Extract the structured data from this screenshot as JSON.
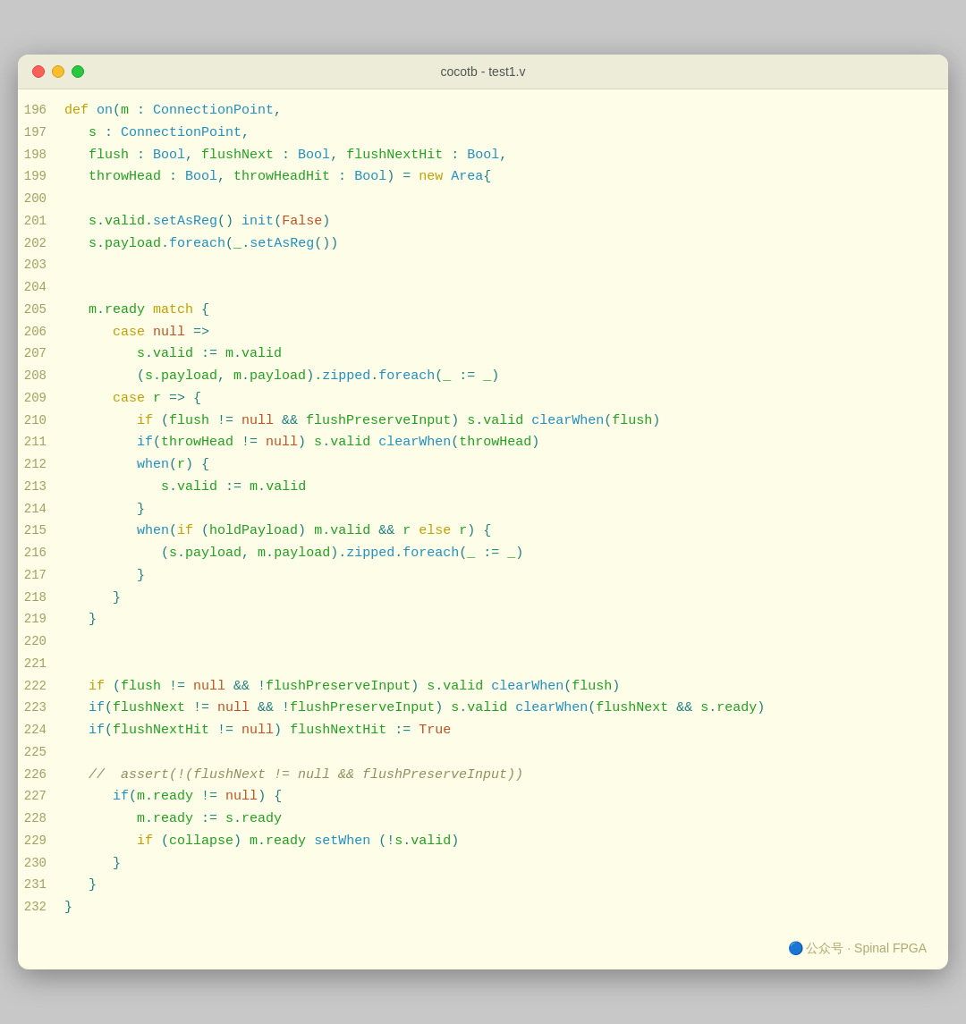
{
  "window": {
    "title": "cocotb - test1.v",
    "traffic_lights": [
      "red",
      "yellow",
      "green"
    ]
  },
  "watermark": "🔵 公众号 · Spinal FPGA",
  "lines": [
    {
      "n": 196,
      "tokens": [
        {
          "t": "kw",
          "v": "def "
        },
        {
          "t": "fn",
          "v": "on"
        },
        {
          "t": "pl",
          "v": "("
        },
        {
          "t": "id",
          "v": "m"
        },
        {
          "t": "pl",
          "v": " : "
        },
        {
          "t": "ty",
          "v": "ConnectionPoint"
        },
        {
          "t": "pl",
          "v": ","
        }
      ]
    },
    {
      "n": 197,
      "tokens": [
        {
          "t": "pl",
          "v": "   "
        },
        {
          "t": "id",
          "v": "s"
        },
        {
          "t": "pl",
          "v": " : "
        },
        {
          "t": "ty",
          "v": "ConnectionPoint"
        },
        {
          "t": "pl",
          "v": ","
        }
      ]
    },
    {
      "n": 198,
      "tokens": [
        {
          "t": "pl",
          "v": "   "
        },
        {
          "t": "id",
          "v": "flush"
        },
        {
          "t": "pl",
          "v": " : "
        },
        {
          "t": "ty",
          "v": "Bool"
        },
        {
          "t": "pl",
          "v": ", "
        },
        {
          "t": "id",
          "v": "flushNext"
        },
        {
          "t": "pl",
          "v": " : "
        },
        {
          "t": "ty",
          "v": "Bool"
        },
        {
          "t": "pl",
          "v": ", "
        },
        {
          "t": "id",
          "v": "flushNextHit"
        },
        {
          "t": "pl",
          "v": " : "
        },
        {
          "t": "ty",
          "v": "Bool"
        },
        {
          "t": "pl",
          "v": ","
        }
      ]
    },
    {
      "n": 199,
      "tokens": [
        {
          "t": "pl",
          "v": "   "
        },
        {
          "t": "id",
          "v": "throwHead"
        },
        {
          "t": "pl",
          "v": " : "
        },
        {
          "t": "ty",
          "v": "Bool"
        },
        {
          "t": "pl",
          "v": ", "
        },
        {
          "t": "id",
          "v": "throwHeadHit"
        },
        {
          "t": "pl",
          "v": " : "
        },
        {
          "t": "ty",
          "v": "Bool"
        },
        {
          "t": "pl",
          "v": ") = "
        },
        {
          "t": "kw",
          "v": "new "
        },
        {
          "t": "ty",
          "v": "Area"
        },
        {
          "t": "pl",
          "v": "{"
        }
      ]
    },
    {
      "n": 200,
      "tokens": []
    },
    {
      "n": 201,
      "tokens": [
        {
          "t": "pl",
          "v": "   "
        },
        {
          "t": "id",
          "v": "s"
        },
        {
          "t": "pl",
          "v": "."
        },
        {
          "t": "id",
          "v": "valid"
        },
        {
          "t": "pl",
          "v": "."
        },
        {
          "t": "fn",
          "v": "setAsReg"
        },
        {
          "t": "pl",
          "v": "() "
        },
        {
          "t": "fn",
          "v": "init"
        },
        {
          "t": "pl",
          "v": "("
        },
        {
          "t": "lit",
          "v": "False"
        },
        {
          "t": "pl",
          "v": ")"
        }
      ]
    },
    {
      "n": 202,
      "tokens": [
        {
          "t": "pl",
          "v": "   "
        },
        {
          "t": "id",
          "v": "s"
        },
        {
          "t": "pl",
          "v": "."
        },
        {
          "t": "id",
          "v": "payload"
        },
        {
          "t": "pl",
          "v": "."
        },
        {
          "t": "fn",
          "v": "foreach"
        },
        {
          "t": "pl",
          "v": "("
        },
        {
          "t": "id",
          "v": "_"
        },
        {
          "t": "pl",
          "v": "."
        },
        {
          "t": "fn",
          "v": "setAsReg"
        },
        {
          "t": "pl",
          "v": "())"
        }
      ]
    },
    {
      "n": 203,
      "tokens": []
    },
    {
      "n": 204,
      "tokens": []
    },
    {
      "n": 205,
      "tokens": [
        {
          "t": "pl",
          "v": "   "
        },
        {
          "t": "id",
          "v": "m"
        },
        {
          "t": "pl",
          "v": "."
        },
        {
          "t": "id",
          "v": "ready"
        },
        {
          "t": "pl",
          "v": " "
        },
        {
          "t": "kw",
          "v": "match"
        },
        {
          "t": "pl",
          "v": " {"
        }
      ]
    },
    {
      "n": 206,
      "tokens": [
        {
          "t": "pl",
          "v": "      "
        },
        {
          "t": "kw",
          "v": "case "
        },
        {
          "t": "lit",
          "v": "null"
        },
        {
          "t": "pl",
          "v": " =>"
        }
      ]
    },
    {
      "n": 207,
      "tokens": [
        {
          "t": "pl",
          "v": "         "
        },
        {
          "t": "id",
          "v": "s"
        },
        {
          "t": "pl",
          "v": "."
        },
        {
          "t": "id",
          "v": "valid"
        },
        {
          "t": "pl",
          "v": " := "
        },
        {
          "t": "id",
          "v": "m"
        },
        {
          "t": "pl",
          "v": "."
        },
        {
          "t": "id",
          "v": "valid"
        }
      ]
    },
    {
      "n": 208,
      "tokens": [
        {
          "t": "pl",
          "v": "         ("
        },
        {
          "t": "id",
          "v": "s"
        },
        {
          "t": "pl",
          "v": "."
        },
        {
          "t": "id",
          "v": "payload"
        },
        {
          "t": "pl",
          "v": ", "
        },
        {
          "t": "id",
          "v": "m"
        },
        {
          "t": "pl",
          "v": "."
        },
        {
          "t": "id",
          "v": "payload"
        },
        {
          "t": "pl",
          "v": ")."
        },
        {
          "t": "fn",
          "v": "zipped"
        },
        {
          "t": "pl",
          "v": "."
        },
        {
          "t": "fn",
          "v": "foreach"
        },
        {
          "t": "pl",
          "v": "("
        },
        {
          "t": "id",
          "v": "_"
        },
        {
          "t": "pl",
          "v": " := "
        },
        {
          "t": "id",
          "v": "_"
        },
        {
          "t": "pl",
          "v": ")"
        }
      ]
    },
    {
      "n": 209,
      "tokens": [
        {
          "t": "pl",
          "v": "      "
        },
        {
          "t": "kw",
          "v": "case "
        },
        {
          "t": "id",
          "v": "r"
        },
        {
          "t": "pl",
          "v": " => {"
        }
      ]
    },
    {
      "n": 210,
      "tokens": [
        {
          "t": "pl",
          "v": "         "
        },
        {
          "t": "kw",
          "v": "if "
        },
        {
          "t": "pl",
          "v": "("
        },
        {
          "t": "id",
          "v": "flush"
        },
        {
          "t": "pl",
          "v": " != "
        },
        {
          "t": "lit",
          "v": "null"
        },
        {
          "t": "pl",
          "v": " && "
        },
        {
          "t": "id",
          "v": "flushPreserveInput"
        },
        {
          "t": "pl",
          "v": ") "
        },
        {
          "t": "id",
          "v": "s"
        },
        {
          "t": "pl",
          "v": "."
        },
        {
          "t": "id",
          "v": "valid"
        },
        {
          "t": "pl",
          "v": " "
        },
        {
          "t": "fn",
          "v": "clearWhen"
        },
        {
          "t": "pl",
          "v": "("
        },
        {
          "t": "id",
          "v": "flush"
        },
        {
          "t": "pl",
          "v": ")"
        }
      ]
    },
    {
      "n": 211,
      "tokens": [
        {
          "t": "pl",
          "v": "         "
        },
        {
          "t": "fn",
          "v": "if"
        },
        {
          "t": "pl",
          "v": "("
        },
        {
          "t": "id",
          "v": "throwHead"
        },
        {
          "t": "pl",
          "v": " != "
        },
        {
          "t": "lit",
          "v": "null"
        },
        {
          "t": "pl",
          "v": ") "
        },
        {
          "t": "id",
          "v": "s"
        },
        {
          "t": "pl",
          "v": "."
        },
        {
          "t": "id",
          "v": "valid"
        },
        {
          "t": "pl",
          "v": " "
        },
        {
          "t": "fn",
          "v": "clearWhen"
        },
        {
          "t": "pl",
          "v": "("
        },
        {
          "t": "id",
          "v": "throwHead"
        },
        {
          "t": "pl",
          "v": ")"
        }
      ]
    },
    {
      "n": 212,
      "tokens": [
        {
          "t": "pl",
          "v": "         "
        },
        {
          "t": "fn",
          "v": "when"
        },
        {
          "t": "pl",
          "v": "("
        },
        {
          "t": "id",
          "v": "r"
        },
        {
          "t": "pl",
          "v": ") {"
        }
      ]
    },
    {
      "n": 213,
      "tokens": [
        {
          "t": "pl",
          "v": "            "
        },
        {
          "t": "id",
          "v": "s"
        },
        {
          "t": "pl",
          "v": "."
        },
        {
          "t": "id",
          "v": "valid"
        },
        {
          "t": "pl",
          "v": " := "
        },
        {
          "t": "id",
          "v": "m"
        },
        {
          "t": "pl",
          "v": "."
        },
        {
          "t": "id",
          "v": "valid"
        }
      ]
    },
    {
      "n": 214,
      "tokens": [
        {
          "t": "pl",
          "v": "         }"
        }
      ]
    },
    {
      "n": 215,
      "tokens": [
        {
          "t": "pl",
          "v": "         "
        },
        {
          "t": "fn",
          "v": "when"
        },
        {
          "t": "pl",
          "v": "("
        },
        {
          "t": "kw",
          "v": "if "
        },
        {
          "t": "pl",
          "v": "("
        },
        {
          "t": "id",
          "v": "holdPayload"
        },
        {
          "t": "pl",
          "v": ") "
        },
        {
          "t": "id",
          "v": "m"
        },
        {
          "t": "pl",
          "v": "."
        },
        {
          "t": "id",
          "v": "valid"
        },
        {
          "t": "pl",
          "v": " && "
        },
        {
          "t": "id",
          "v": "r"
        },
        {
          "t": "pl",
          "v": " "
        },
        {
          "t": "kw",
          "v": "else "
        },
        {
          "t": "id",
          "v": "r"
        },
        {
          "t": "pl",
          "v": ") {"
        }
      ]
    },
    {
      "n": 216,
      "tokens": [
        {
          "t": "pl",
          "v": "            ("
        },
        {
          "t": "id",
          "v": "s"
        },
        {
          "t": "pl",
          "v": "."
        },
        {
          "t": "id",
          "v": "payload"
        },
        {
          "t": "pl",
          "v": ", "
        },
        {
          "t": "id",
          "v": "m"
        },
        {
          "t": "pl",
          "v": "."
        },
        {
          "t": "id",
          "v": "payload"
        },
        {
          "t": "pl",
          "v": ")."
        },
        {
          "t": "fn",
          "v": "zipped"
        },
        {
          "t": "pl",
          "v": "."
        },
        {
          "t": "fn",
          "v": "foreach"
        },
        {
          "t": "pl",
          "v": "("
        },
        {
          "t": "id",
          "v": "_"
        },
        {
          "t": "pl",
          "v": " := "
        },
        {
          "t": "id",
          "v": "_"
        },
        {
          "t": "pl",
          "v": ")"
        }
      ]
    },
    {
      "n": 217,
      "tokens": [
        {
          "t": "pl",
          "v": "         }"
        }
      ]
    },
    {
      "n": 218,
      "tokens": [
        {
          "t": "pl",
          "v": "      }"
        }
      ]
    },
    {
      "n": 219,
      "tokens": [
        {
          "t": "pl",
          "v": "   }"
        }
      ]
    },
    {
      "n": 220,
      "tokens": []
    },
    {
      "n": 221,
      "tokens": []
    },
    {
      "n": 222,
      "tokens": [
        {
          "t": "pl",
          "v": "   "
        },
        {
          "t": "kw",
          "v": "if "
        },
        {
          "t": "pl",
          "v": "("
        },
        {
          "t": "id",
          "v": "flush"
        },
        {
          "t": "pl",
          "v": " != "
        },
        {
          "t": "lit",
          "v": "null"
        },
        {
          "t": "pl",
          "v": " && !"
        },
        {
          "t": "id",
          "v": "flushPreserveInput"
        },
        {
          "t": "pl",
          "v": ") "
        },
        {
          "t": "id",
          "v": "s"
        },
        {
          "t": "pl",
          "v": "."
        },
        {
          "t": "id",
          "v": "valid"
        },
        {
          "t": "pl",
          "v": " "
        },
        {
          "t": "fn",
          "v": "clearWhen"
        },
        {
          "t": "pl",
          "v": "("
        },
        {
          "t": "id",
          "v": "flush"
        },
        {
          "t": "pl",
          "v": ")"
        }
      ]
    },
    {
      "n": 223,
      "tokens": [
        {
          "t": "pl",
          "v": "   "
        },
        {
          "t": "fn",
          "v": "if"
        },
        {
          "t": "pl",
          "v": "("
        },
        {
          "t": "id",
          "v": "flushNext"
        },
        {
          "t": "pl",
          "v": " != "
        },
        {
          "t": "lit",
          "v": "null"
        },
        {
          "t": "pl",
          "v": " && !"
        },
        {
          "t": "id",
          "v": "flushPreserveInput"
        },
        {
          "t": "pl",
          "v": ") "
        },
        {
          "t": "id",
          "v": "s"
        },
        {
          "t": "pl",
          "v": "."
        },
        {
          "t": "id",
          "v": "valid"
        },
        {
          "t": "pl",
          "v": " "
        },
        {
          "t": "fn",
          "v": "clearWhen"
        },
        {
          "t": "pl",
          "v": "("
        },
        {
          "t": "id",
          "v": "flushNext"
        },
        {
          "t": "pl",
          "v": " && "
        },
        {
          "t": "id",
          "v": "s"
        },
        {
          "t": "pl",
          "v": "."
        },
        {
          "t": "id",
          "v": "ready"
        },
        {
          "t": "pl",
          "v": ")"
        }
      ]
    },
    {
      "n": 224,
      "tokens": [
        {
          "t": "pl",
          "v": "   "
        },
        {
          "t": "fn",
          "v": "if"
        },
        {
          "t": "pl",
          "v": "("
        },
        {
          "t": "id",
          "v": "flushNextHit"
        },
        {
          "t": "pl",
          "v": " != "
        },
        {
          "t": "lit",
          "v": "null"
        },
        {
          "t": "pl",
          "v": ") "
        },
        {
          "t": "id",
          "v": "flushNextHit"
        },
        {
          "t": "pl",
          "v": " := "
        },
        {
          "t": "lit",
          "v": "True"
        }
      ]
    },
    {
      "n": 225,
      "tokens": []
    },
    {
      "n": 226,
      "tokens": [
        {
          "t": "pl",
          "v": "   "
        },
        {
          "t": "cm",
          "v": "//  assert(!(flushNext != null && flushPreserveInput))"
        }
      ]
    },
    {
      "n": 227,
      "tokens": [
        {
          "t": "pl",
          "v": "      "
        },
        {
          "t": "fn",
          "v": "if"
        },
        {
          "t": "pl",
          "v": "("
        },
        {
          "t": "id",
          "v": "m"
        },
        {
          "t": "pl",
          "v": "."
        },
        {
          "t": "id",
          "v": "ready"
        },
        {
          "t": "pl",
          "v": " != "
        },
        {
          "t": "lit",
          "v": "null"
        },
        {
          "t": "pl",
          "v": ") {"
        }
      ]
    },
    {
      "n": 228,
      "tokens": [
        {
          "t": "pl",
          "v": "         "
        },
        {
          "t": "id",
          "v": "m"
        },
        {
          "t": "pl",
          "v": "."
        },
        {
          "t": "id",
          "v": "ready"
        },
        {
          "t": "pl",
          "v": " := "
        },
        {
          "t": "id",
          "v": "s"
        },
        {
          "t": "pl",
          "v": "."
        },
        {
          "t": "id",
          "v": "ready"
        }
      ]
    },
    {
      "n": 229,
      "tokens": [
        {
          "t": "pl",
          "v": "         "
        },
        {
          "t": "kw",
          "v": "if "
        },
        {
          "t": "pl",
          "v": "("
        },
        {
          "t": "id",
          "v": "collapse"
        },
        {
          "t": "pl",
          "v": ") "
        },
        {
          "t": "id",
          "v": "m"
        },
        {
          "t": "pl",
          "v": "."
        },
        {
          "t": "id",
          "v": "ready"
        },
        {
          "t": "pl",
          "v": " "
        },
        {
          "t": "fn",
          "v": "setWhen"
        },
        {
          "t": "pl",
          "v": " (!"
        },
        {
          "t": "id",
          "v": "s"
        },
        {
          "t": "pl",
          "v": "."
        },
        {
          "t": "id",
          "v": "valid"
        },
        {
          "t": "pl",
          "v": ")"
        }
      ]
    },
    {
      "n": 230,
      "tokens": [
        {
          "t": "pl",
          "v": "      }"
        }
      ]
    },
    {
      "n": 231,
      "tokens": [
        {
          "t": "pl",
          "v": "   }"
        }
      ]
    },
    {
      "n": 232,
      "tokens": [
        {
          "t": "pl",
          "v": "}"
        }
      ]
    }
  ]
}
